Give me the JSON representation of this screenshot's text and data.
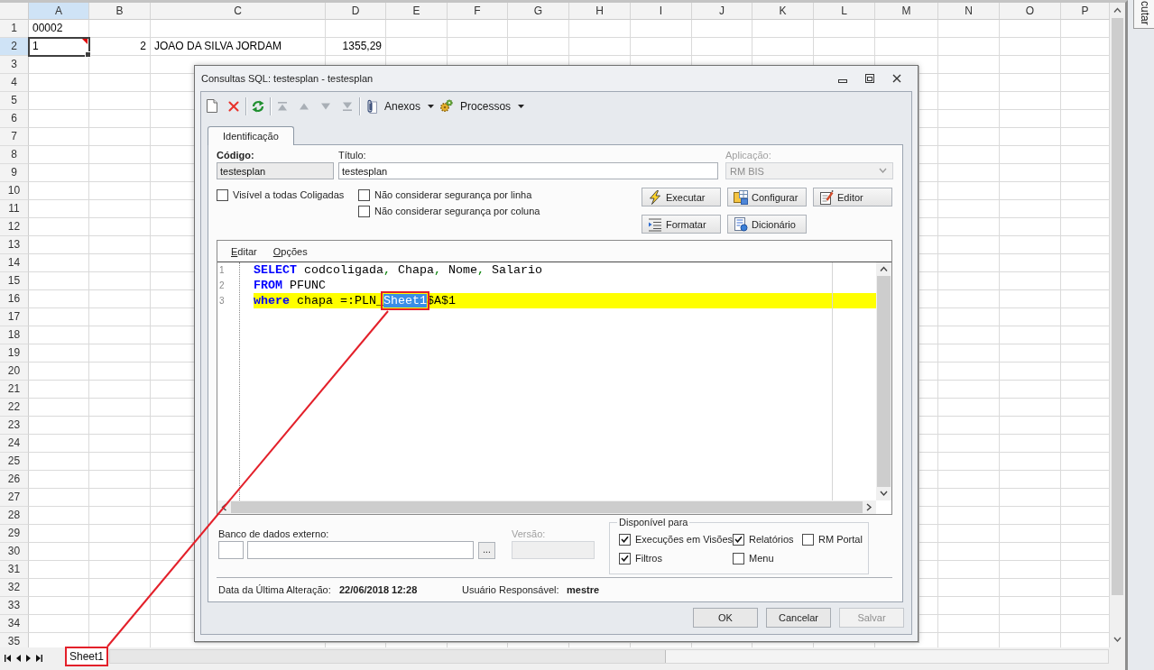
{
  "spreadsheet": {
    "columns": [
      {
        "label": "A",
        "selected": true
      },
      {
        "label": "B",
        "selected": false
      },
      {
        "label": "C",
        "selected": false
      },
      {
        "label": "D",
        "selected": false
      },
      {
        "label": "E",
        "selected": false
      },
      {
        "label": "F",
        "selected": false
      },
      {
        "label": "G",
        "selected": false
      },
      {
        "label": "H",
        "selected": false
      },
      {
        "label": "I",
        "selected": false
      },
      {
        "label": "J",
        "selected": false
      },
      {
        "label": "K",
        "selected": false
      },
      {
        "label": "L",
        "selected": false
      },
      {
        "label": "M",
        "selected": false
      },
      {
        "label": "N",
        "selected": false
      },
      {
        "label": "O",
        "selected": false
      },
      {
        "label": "P",
        "selected": false
      }
    ],
    "rows": [
      {
        "number": "1",
        "selected": false,
        "cells": [
          {
            "value": "00002",
            "kind": "text",
            "selected": false,
            "comment": false
          }
        ]
      },
      {
        "number": "2",
        "selected": true,
        "cells": [
          {
            "value": "1",
            "kind": "text",
            "selected": true,
            "comment": true
          },
          {
            "value": "2",
            "kind": "number",
            "selected": false,
            "comment": false
          },
          {
            "value": "JOAO DA SILVA JORDAM",
            "kind": "text",
            "selected": false,
            "comment": false
          },
          {
            "value": "1355,29",
            "kind": "number",
            "selected": false,
            "comment": false
          }
        ]
      },
      {
        "number": "3",
        "selected": false
      },
      {
        "number": "4",
        "selected": false
      },
      {
        "number": "5",
        "selected": false
      },
      {
        "number": "6",
        "selected": false
      },
      {
        "number": "7",
        "selected": false
      },
      {
        "number": "8",
        "selected": false
      },
      {
        "number": "9",
        "selected": false
      },
      {
        "number": "10",
        "selected": false
      },
      {
        "number": "11",
        "selected": false
      },
      {
        "number": "12",
        "selected": false
      },
      {
        "number": "13",
        "selected": false
      },
      {
        "number": "14",
        "selected": false
      },
      {
        "number": "15",
        "selected": false
      },
      {
        "number": "16",
        "selected": false
      },
      {
        "number": "17",
        "selected": false
      },
      {
        "number": "18",
        "selected": false
      },
      {
        "number": "19",
        "selected": false
      },
      {
        "number": "20",
        "selected": false
      },
      {
        "number": "21",
        "selected": false
      },
      {
        "number": "22",
        "selected": false
      },
      {
        "number": "23",
        "selected": false
      },
      {
        "number": "24",
        "selected": false
      },
      {
        "number": "25",
        "selected": false
      },
      {
        "number": "26",
        "selected": false
      },
      {
        "number": "27",
        "selected": false
      },
      {
        "number": "28",
        "selected": false
      },
      {
        "number": "29",
        "selected": false
      },
      {
        "number": "30",
        "selected": false
      },
      {
        "number": "31",
        "selected": false
      },
      {
        "number": "32",
        "selected": false
      },
      {
        "number": "33",
        "selected": false
      },
      {
        "number": "34",
        "selected": false
      },
      {
        "number": "35",
        "selected": false
      }
    ],
    "sheet_tabs": [
      {
        "label": "Sheet1",
        "selected": true,
        "framed": true
      }
    ]
  },
  "side_panel": {
    "tab_label": "cutar"
  },
  "dialog": {
    "title": "Consultas SQL: testesplan - testesplan",
    "toolbar": [
      {
        "kind": "new",
        "disabled": false
      },
      {
        "kind": "delete",
        "disabled": false
      },
      {
        "kind": "separator"
      },
      {
        "kind": "refresh",
        "disabled": false
      },
      {
        "kind": "separator"
      },
      {
        "kind": "first",
        "disabled": true
      },
      {
        "kind": "previous",
        "disabled": true
      },
      {
        "kind": "next",
        "disabled": true
      },
      {
        "kind": "last",
        "disabled": true
      },
      {
        "kind": "separator"
      },
      {
        "kind": "attachments",
        "label": "Anexos",
        "disabled": false
      },
      {
        "kind": "processes",
        "label": "Processos",
        "disabled": false
      }
    ],
    "tabs": [
      {
        "label": "Identificação",
        "selected": true
      }
    ],
    "fields": [
      {
        "kind": "text",
        "label": "Código:",
        "value": "testesplan",
        "required": true,
        "readonly": true,
        "disabled": false
      },
      {
        "kind": "text",
        "label": "Título:",
        "value": "testesplan",
        "required": false,
        "readonly": false,
        "disabled": false
      },
      {
        "kind": "select",
        "label": "Aplicação:",
        "value": "RM BIS",
        "required": false,
        "disabled": true
      }
    ],
    "options": [
      {
        "label": "Visível a todas Coligadas",
        "checked": false
      },
      {
        "label": "Não considerar segurança por linha",
        "checked": false
      },
      {
        "label": "Não considerar segurança por coluna",
        "checked": false
      }
    ],
    "actions": [
      {
        "kind": "run",
        "label": "Executar"
      },
      {
        "kind": "configure",
        "label": "Configurar"
      },
      {
        "kind": "editor",
        "label": "Editor"
      },
      {
        "kind": "format",
        "label": "Formatar"
      },
      {
        "kind": "dictionary",
        "label": "Dicionário"
      }
    ],
    "editor": {
      "menu": [
        {
          "label": "Editar"
        },
        {
          "label": "Opções"
        }
      ],
      "lines": [
        {
          "number": "1",
          "current": false,
          "tokens": [
            {
              "text": "SELECT",
              "kind": "keyword"
            },
            {
              "text": " codcoligada",
              "kind": "plain"
            },
            {
              "text": ",",
              "kind": "punct"
            },
            {
              "text": " Chapa",
              "kind": "plain"
            },
            {
              "text": ",",
              "kind": "punct"
            },
            {
              "text": " Nome",
              "kind": "plain"
            },
            {
              "text": ",",
              "kind": "punct"
            },
            {
              "text": " Salario",
              "kind": "plain"
            }
          ]
        },
        {
          "number": "2",
          "current": false,
          "tokens": [
            {
              "text": "FROM",
              "kind": "keyword"
            },
            {
              "text": " PFUNC",
              "kind": "plain"
            }
          ]
        },
        {
          "number": "3",
          "current": true,
          "tokens": [
            {
              "text": "where",
              "kind": "keyword"
            },
            {
              "text": " chapa =:PLN_",
              "kind": "plain"
            },
            {
              "text": "Sheet1",
              "kind": "selection"
            },
            {
              "text": "$A$1",
              "kind": "plain"
            }
          ]
        }
      ]
    },
    "external_database": {
      "label": "Banco de dados externo:",
      "browse_button": "..."
    },
    "version": {
      "label": "Versão:",
      "disabled": true
    },
    "available_for": {
      "title": "Disponível para",
      "options": [
        {
          "label": "Execuções em Visões",
          "checked": true
        },
        {
          "label": "Relatórios",
          "checked": true
        },
        {
          "label": "RM Portal",
          "checked": false
        },
        {
          "label": "Filtros",
          "checked": true
        },
        {
          "label": "Menu",
          "checked": false
        }
      ]
    },
    "footer": [
      {
        "label": "Data da Última Alteração:",
        "value": "22/06/2018 12:28"
      },
      {
        "label": "Usuário Responsável:",
        "value": "mestre"
      }
    ],
    "buttons": [
      {
        "label": "OK",
        "disabled": false
      },
      {
        "label": "Cancelar",
        "disabled": false
      },
      {
        "label": "Salvar",
        "disabled": true
      }
    ]
  }
}
